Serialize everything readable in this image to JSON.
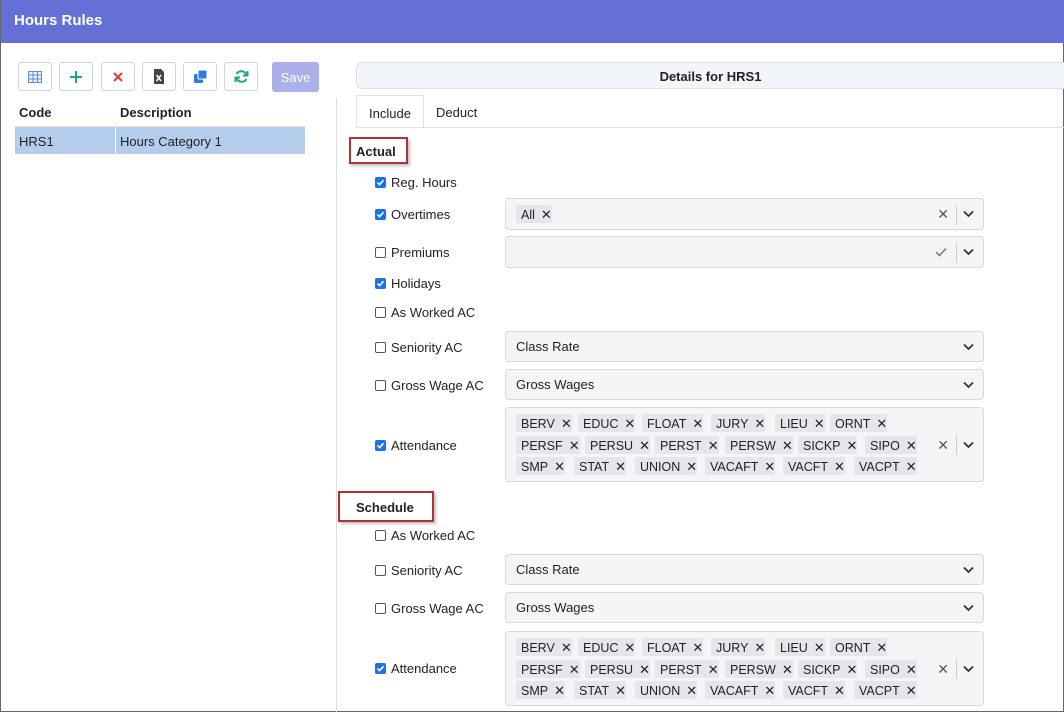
{
  "window": {
    "title": "Hours Rules"
  },
  "toolbar": {
    "save_label": "Save"
  },
  "grid": {
    "columns": [
      "Code",
      "Description"
    ],
    "rows": [
      {
        "code": "HRS1",
        "description": "Hours Category 1"
      }
    ]
  },
  "details": {
    "header": "Details for HRS1"
  },
  "tabs": [
    {
      "label": "Include"
    },
    {
      "label": "Deduct"
    }
  ],
  "actual": {
    "title": "Actual",
    "reg_hours": {
      "label": "Reg. Hours",
      "checked": true
    },
    "overtimes": {
      "label": "Overtimes",
      "checked": true,
      "chips": [
        "All"
      ]
    },
    "premiums": {
      "label": "Premiums",
      "checked": false
    },
    "holidays": {
      "label": "Holidays",
      "checked": true
    },
    "as_worked": {
      "label": "As Worked AC",
      "checked": false
    },
    "seniority": {
      "label": "Seniority AC",
      "checked": false,
      "value": "Class Rate"
    },
    "gross_wage": {
      "label": "Gross Wage AC",
      "checked": false,
      "value": "Gross Wages"
    },
    "attendance": {
      "label": "Attendance",
      "checked": true,
      "chips": [
        "BERV",
        "EDUC",
        "FLOAT",
        "JURY",
        "LIEU",
        "ORNT",
        "PERSF",
        "PERSU",
        "PERST",
        "PERSW",
        "SICKP",
        "SIPO",
        "SMP",
        "STAT",
        "UNION",
        "VACAFT",
        "VACFT",
        "VACPT"
      ]
    }
  },
  "schedule": {
    "title": "Schedule",
    "as_worked": {
      "label": "As Worked AC",
      "checked": false
    },
    "seniority": {
      "label": "Seniority AC",
      "checked": false,
      "value": "Class Rate"
    },
    "gross_wage": {
      "label": "Gross Wage AC",
      "checked": false,
      "value": "Gross Wages"
    },
    "attendance": {
      "label": "Attendance",
      "checked": true,
      "chips": [
        "BERV",
        "EDUC",
        "FLOAT",
        "JURY",
        "LIEU",
        "ORNT",
        "PERSF",
        "PERSU",
        "PERST",
        "PERSW",
        "SICKP",
        "SIPO",
        "SMP",
        "STAT",
        "UNION",
        "VACAFT",
        "VACFT",
        "VACPT"
      ]
    }
  },
  "icons": {
    "grid": "grid-icon",
    "add": "plus-icon",
    "delete": "delete-x-icon",
    "excel": "excel-file-icon",
    "copy": "copy-icon",
    "refresh": "refresh-icon",
    "clear": "clear-x-icon",
    "check": "check-icon",
    "chevron": "chevron-down-icon"
  },
  "colors": {
    "title_bar": "#6570d6",
    "accent_green": "#1ba784",
    "delete_red": "#e23b3b",
    "selected_row": "#b4cdec",
    "highlight_box": "#b2303a"
  }
}
